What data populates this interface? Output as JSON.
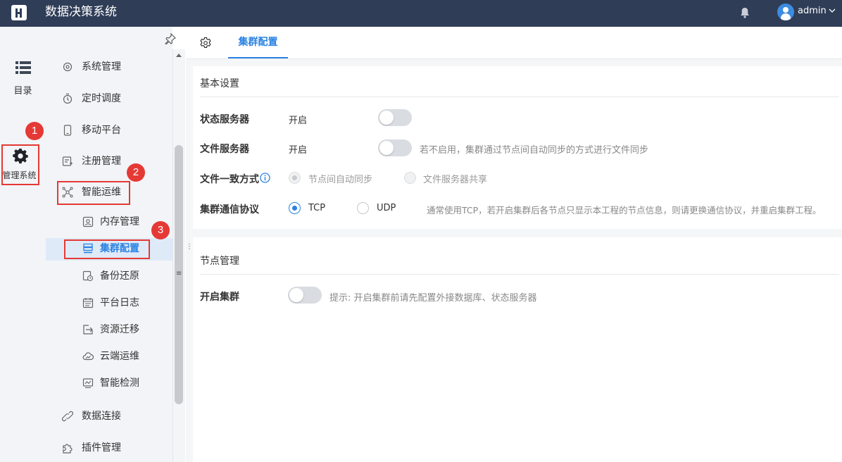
{
  "header": {
    "app_title": "数据决策系统",
    "user_name": "admin"
  },
  "rail": {
    "catalog_label": "目录",
    "admin_label": "管理系统"
  },
  "menu": {
    "system_manage": "系统管理",
    "schedule": "定时调度",
    "mobile": "移动平台",
    "register": "注册管理",
    "smart_ops": "智能运维",
    "memory": "内存管理",
    "cluster": "集群配置",
    "backup": "备份还原",
    "platform_log": "平台日志",
    "migration": "资源迁移",
    "cloud_ops": "云端运维",
    "smart_check": "智能检测",
    "data_conn": "数据连接",
    "plugin": "插件管理"
  },
  "badges": [
    "1",
    "2",
    "3"
  ],
  "tabs": {
    "cluster_tab": "集群配置"
  },
  "basic": {
    "title": "基本设置",
    "state_server_label": "状态服务器",
    "state_server_value": "开启",
    "file_server_label": "文件服务器",
    "file_server_value": "开启",
    "file_server_hint": "若不启用，集群通过节点间自动同步的方式进行文件同步",
    "consistency_label": "文件一致方式",
    "consistency_opt1": "节点间自动同步",
    "consistency_opt2": "文件服务器共享",
    "protocol_label": "集群通信协议",
    "protocol_tcp": "TCP",
    "protocol_udp": "UDP",
    "protocol_hint": "通常使用TCP，若开启集群后各节点只显示本工程的节点信息，则请更换通信协议，并重启集群工程。"
  },
  "node": {
    "title": "节点管理",
    "enable_label": "开启集群",
    "enable_hint": "提示:  开启集群前请先配置外接数据库、状态服务器"
  },
  "colors": {
    "topbar": "#2f3d57",
    "accent": "#2b82e2",
    "highlight_box": "#e53935"
  }
}
